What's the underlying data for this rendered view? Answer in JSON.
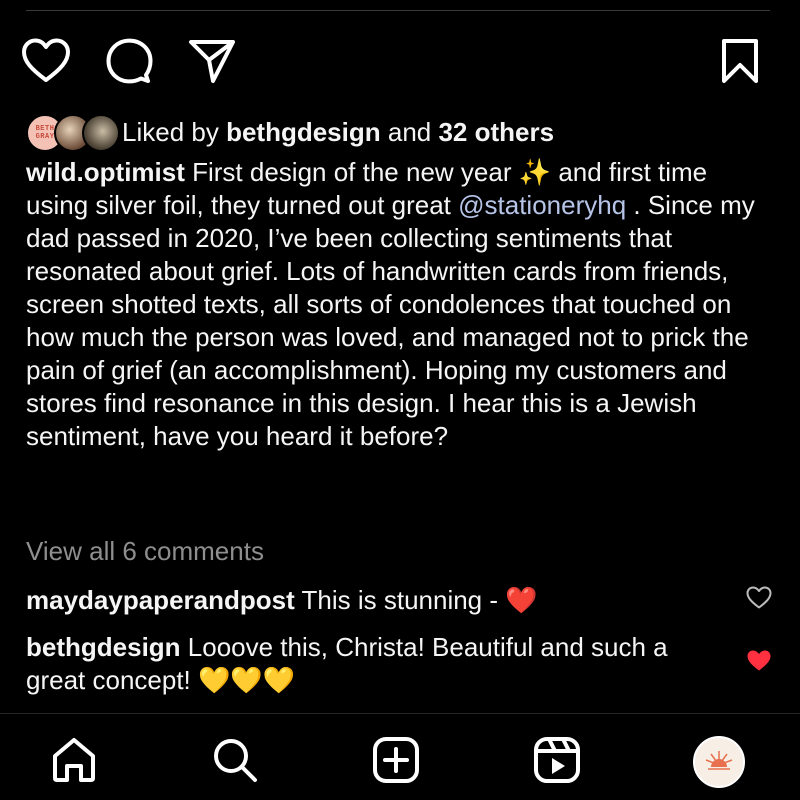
{
  "post": {
    "liked_by_prefix": "Liked by ",
    "liked_by_user": "bethgdesign",
    "liked_by_and": " and ",
    "liked_by_others": "32 others",
    "avatar1_text": "BETH GRAY",
    "author": "wild.optimist",
    "caption_part1": " First design of the new year ",
    "sparkle_emoji": "✨",
    "caption_part2": " and first time using silver foil, they turned out great ",
    "mention": "@stationeryhq",
    "caption_part3": " . Since my dad passed in 2020, I’ve been collecting sentiments that resonated about grief. Lots of handwritten cards from friends, screen shotted texts, all sorts of condolences that touched on how much the person was loved, and managed not to prick the pain of grief (an accomplishment). Hoping my customers and stores find resonance in this design. I hear this is a Jewish sentiment, have you heard it before?",
    "view_all_comments": "View all 6 comments"
  },
  "comments": [
    {
      "user": "maydaypaperandpost",
      "text": " This is stunning - ",
      "emoji": "❤️",
      "liked": false
    },
    {
      "user": "bethgdesign",
      "text": " Looove this, Christa! Beautiful and such a great concept! ",
      "emoji": "💛💛💛",
      "liked": true
    }
  ],
  "icons": {
    "like": "heart-icon",
    "comment": "comment-icon",
    "share": "send-icon",
    "save": "bookmark-icon",
    "tab_home": "home-icon",
    "tab_search": "search-icon",
    "tab_create": "plus-square-icon",
    "tab_reels": "reels-icon",
    "tab_profile": "profile-avatar"
  },
  "colors": {
    "background": "#000000",
    "text": "#f5f5f5",
    "muted": "#8e8e8e",
    "mention": "#b6c4e8",
    "liked_heart": "#ff3040"
  }
}
